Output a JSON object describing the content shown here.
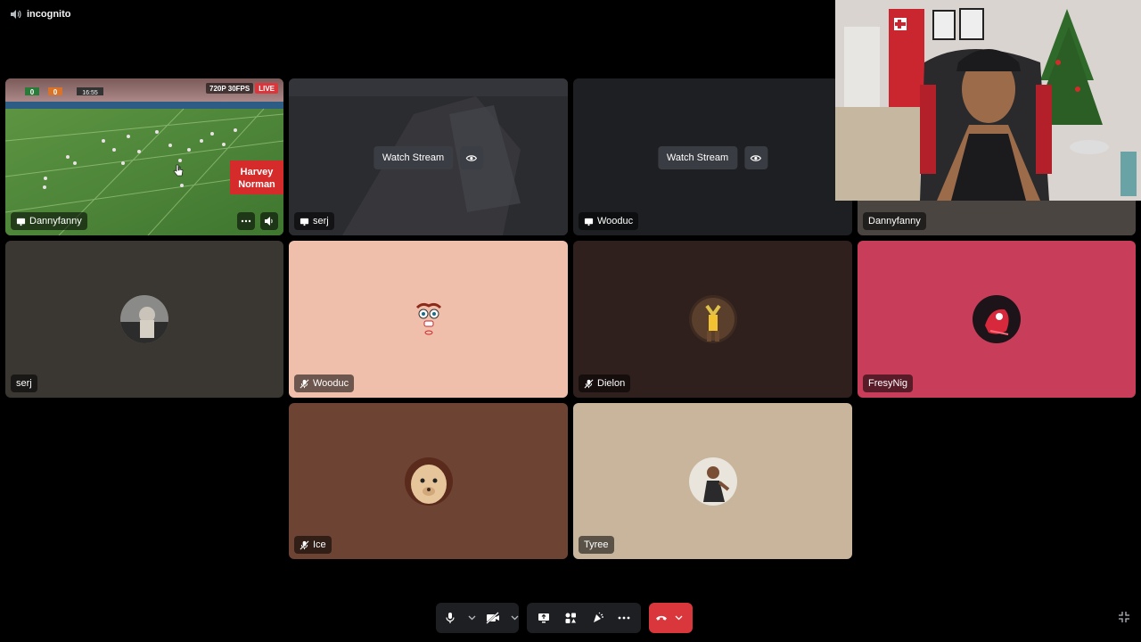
{
  "app": {
    "title": "incognito"
  },
  "stream": {
    "quality_badge": "720P 30FPS",
    "live_badge": "LIVE",
    "sponsor_line1": "Harvey",
    "sponsor_line2": "Norman",
    "score_home": "0",
    "score_away": "0",
    "clock": "16:55"
  },
  "tiles": {
    "dannyfanny_stream": {
      "name": "Dannyfanny"
    },
    "serj_stream": {
      "name": "serj",
      "watch_label": "Watch Stream"
    },
    "wooduc_stream": {
      "name": "Wooduc",
      "watch_label": "Watch Stream"
    },
    "dannyfanny_cam": {
      "name": "Dannyfanny"
    },
    "serj": {
      "name": "serj",
      "bg": "#3a3631"
    },
    "wooduc": {
      "name": "Wooduc",
      "bg": "#f0bfab"
    },
    "dielon": {
      "name": "Dielon",
      "bg": "#2f201d"
    },
    "fresynig": {
      "name": "FresyNig",
      "bg": "#c83d59"
    },
    "ice": {
      "name": "Ice",
      "bg": "#6d4434"
    },
    "tyree": {
      "name": "Tyree",
      "bg": "#c8b59c"
    }
  },
  "colors": {
    "background": "#000000",
    "hangup": "#da373c",
    "control_bar": "#1e1f22"
  }
}
